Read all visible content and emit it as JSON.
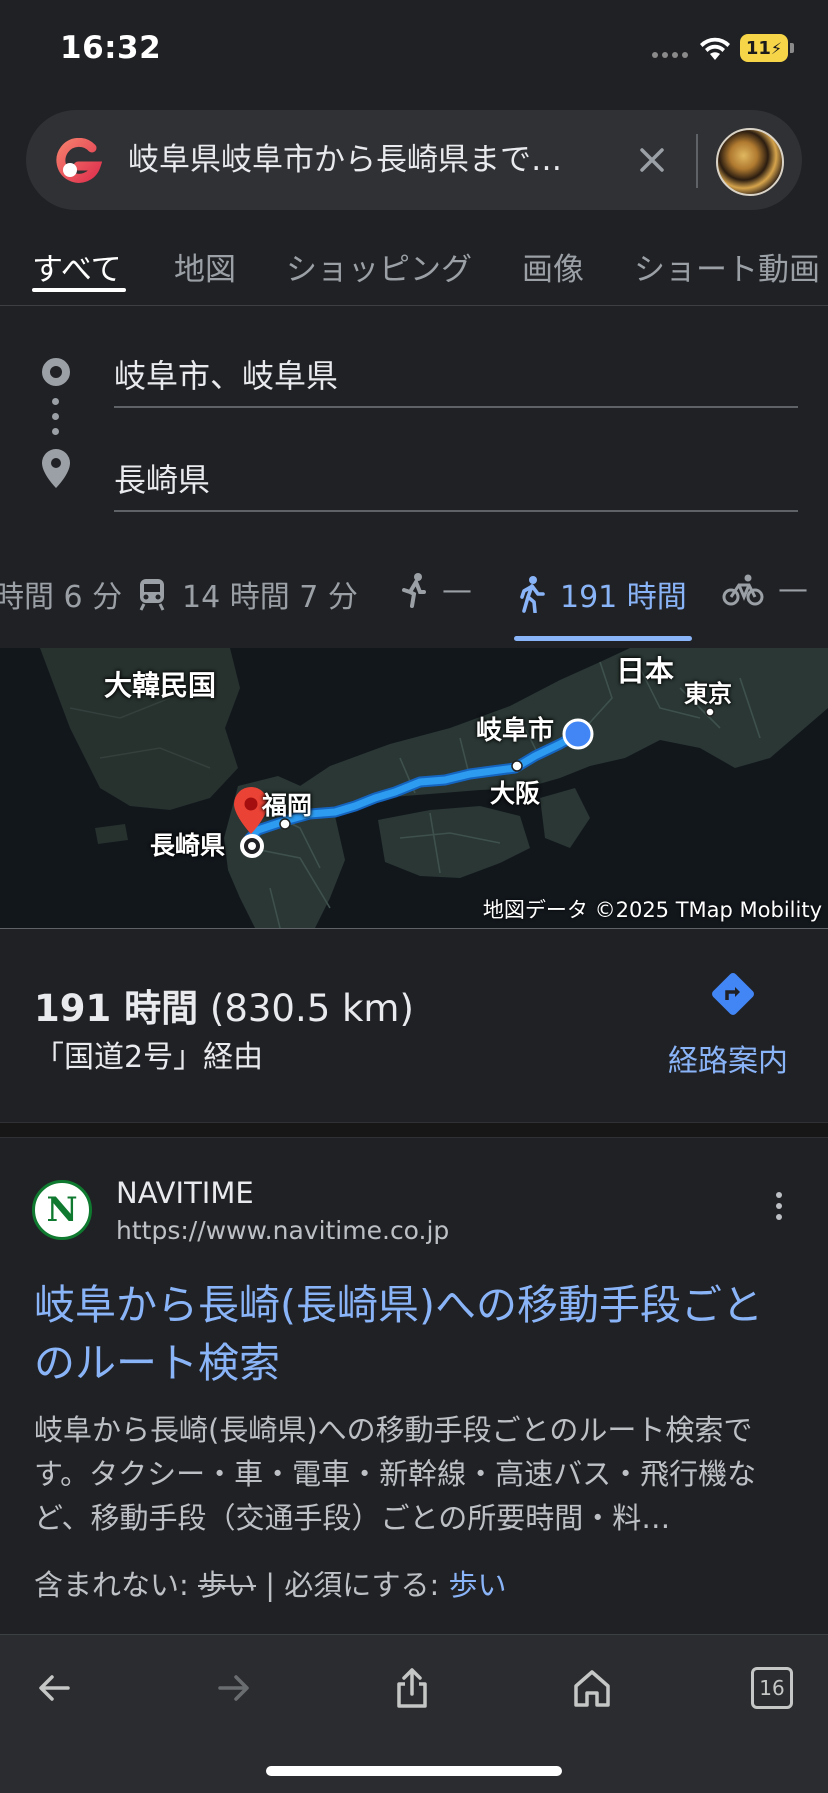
{
  "status": {
    "time": "16:32",
    "battery": "11"
  },
  "search": {
    "query": "岐阜県岐阜市から長崎県まで…"
  },
  "tabs": [
    {
      "label": "すべて",
      "active": true
    },
    {
      "label": "地図"
    },
    {
      "label": "ショッピング"
    },
    {
      "label": "画像"
    },
    {
      "label": "ショート動画"
    }
  ],
  "directions": {
    "origin": "岐阜市、岐阜県",
    "destination": "長崎県"
  },
  "modes": [
    {
      "label": "時間 6 分",
      "icon": "car-icon"
    },
    {
      "label": "14 時間 7 分",
      "icon": "train-icon"
    },
    {
      "label": "—",
      "icon": "rideshare-icon"
    },
    {
      "label": "191 時間",
      "icon": "walk-icon",
      "active": true
    },
    {
      "label": "—",
      "icon": "bike-icon"
    }
  ],
  "map": {
    "labels": {
      "korea": "大韓民国",
      "japan": "日本",
      "tokyo": "東京",
      "gifu": "岐阜市",
      "osaka": "大阪",
      "fukuoka": "福岡",
      "nagasaki": "長崎県"
    },
    "credit": "地図データ ©2025 TMap Mobility",
    "route_color": "#2d9bf0"
  },
  "summary": {
    "duration": "191 時間",
    "distance": "(830.5 km)",
    "via": "「国道2号」経由",
    "nav_label": "経路案内"
  },
  "result": {
    "favicon_letter": "N",
    "site_name": "NAVITIME",
    "url": "https://www.navitime.co.jp",
    "title": "岐阜から長崎(長崎県)への移動手段ごとのルート検索",
    "snippet": "岐阜から長崎(長崎県)への移動手段ごとのルート検索です。タクシー・車・電車・新幹線・高速バス・飛行機など、移動手段（交通手段）ごとの所要時間・料…",
    "missing_label": "含まれない:",
    "missing_term": "歩い",
    "required_label": "| 必須にする:",
    "required_term": "歩い"
  },
  "bottom_bar": {
    "tab_count": "16"
  }
}
